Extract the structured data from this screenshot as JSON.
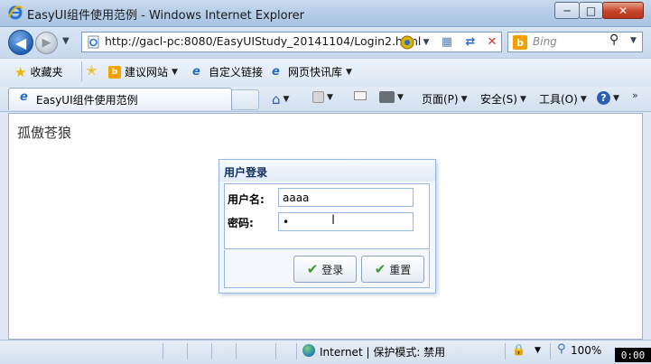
{
  "window": {
    "title": "EasyUI组件使用范例 - Windows Internet Explorer",
    "min_glyph": "─",
    "max_glyph": "□",
    "close_glyph": "✕"
  },
  "nav": {
    "back_glyph": "◀",
    "forward_glyph": "▶",
    "address": "http://gacl-pc:8080/EasyUIStudy_20141104/Login2.html",
    "search_placeholder": "Bing"
  },
  "favorites_bar": {
    "favorites_label": "收藏夹",
    "items": [
      {
        "label": "建议网站",
        "icon": "bing-icon"
      },
      {
        "label": "自定义链接",
        "icon": "ie-icon"
      },
      {
        "label": "网页快讯库",
        "icon": "ie-icon"
      }
    ]
  },
  "tab": {
    "label": "EasyUI组件使用范例"
  },
  "command_bar": {
    "page_label": "页面(P)",
    "safety_label": "安全(S)",
    "tools_label": "工具(O)",
    "help_glyph": "?",
    "more_glyph": "»"
  },
  "content": {
    "nickname": "孤傲苍狼"
  },
  "login": {
    "title": "用户登录",
    "username_label": "用户名:",
    "username_value": "aaaa",
    "password_label": "密码:",
    "password_value": "a",
    "login_button": "登录",
    "reset_button": "重置"
  },
  "statusbar": {
    "zone": "Internet | 保护模式: 禁用",
    "zoom": "100%",
    "timer": "0:00"
  },
  "colors": {
    "panel_border": "#95b8e7",
    "panel_title": "#0e2d5f",
    "close_button": "#c6452a",
    "check_icon": "#3a9a2a"
  }
}
